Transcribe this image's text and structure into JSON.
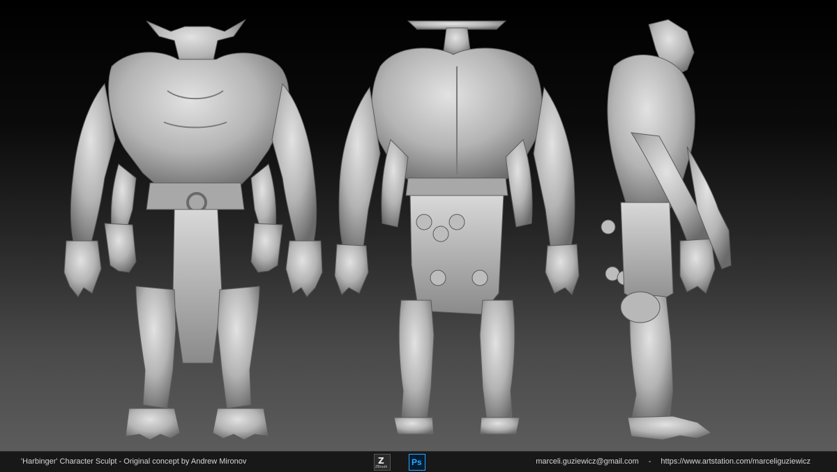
{
  "footer": {
    "credit": "'Harbinger' Character Sculpt - Original concept by Andrew Mironov",
    "zbrush_logo_mark": "Z",
    "zbrush_logo_word": "ZBrush",
    "photoshop_logo": "Ps",
    "email": "marceli.guziewicz@gmail.com",
    "separator": "-",
    "website": "https://www.artstation.com/marceliguziewicz"
  },
  "colors": {
    "sculpt_clay": "#c9c9c9",
    "sculpt_shadow": "#6e6e6e",
    "footer_bg": "#181818",
    "footer_text": "#d6d6d6",
    "photoshop_accent": "#31a8ff"
  },
  "icons": [
    "zbrush-logo-icon",
    "photoshop-logo-icon"
  ]
}
